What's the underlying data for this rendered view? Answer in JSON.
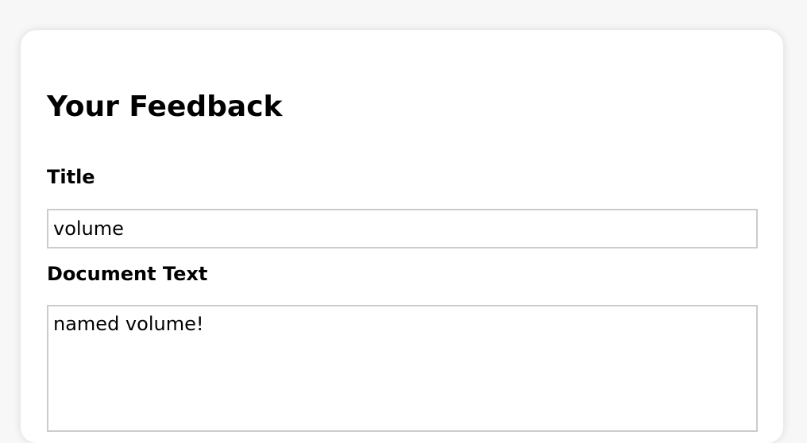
{
  "form": {
    "heading": "Your Feedback",
    "title_label": "Title",
    "title_value": "volume",
    "document_label": "Document Text",
    "document_value": "named volume!"
  }
}
